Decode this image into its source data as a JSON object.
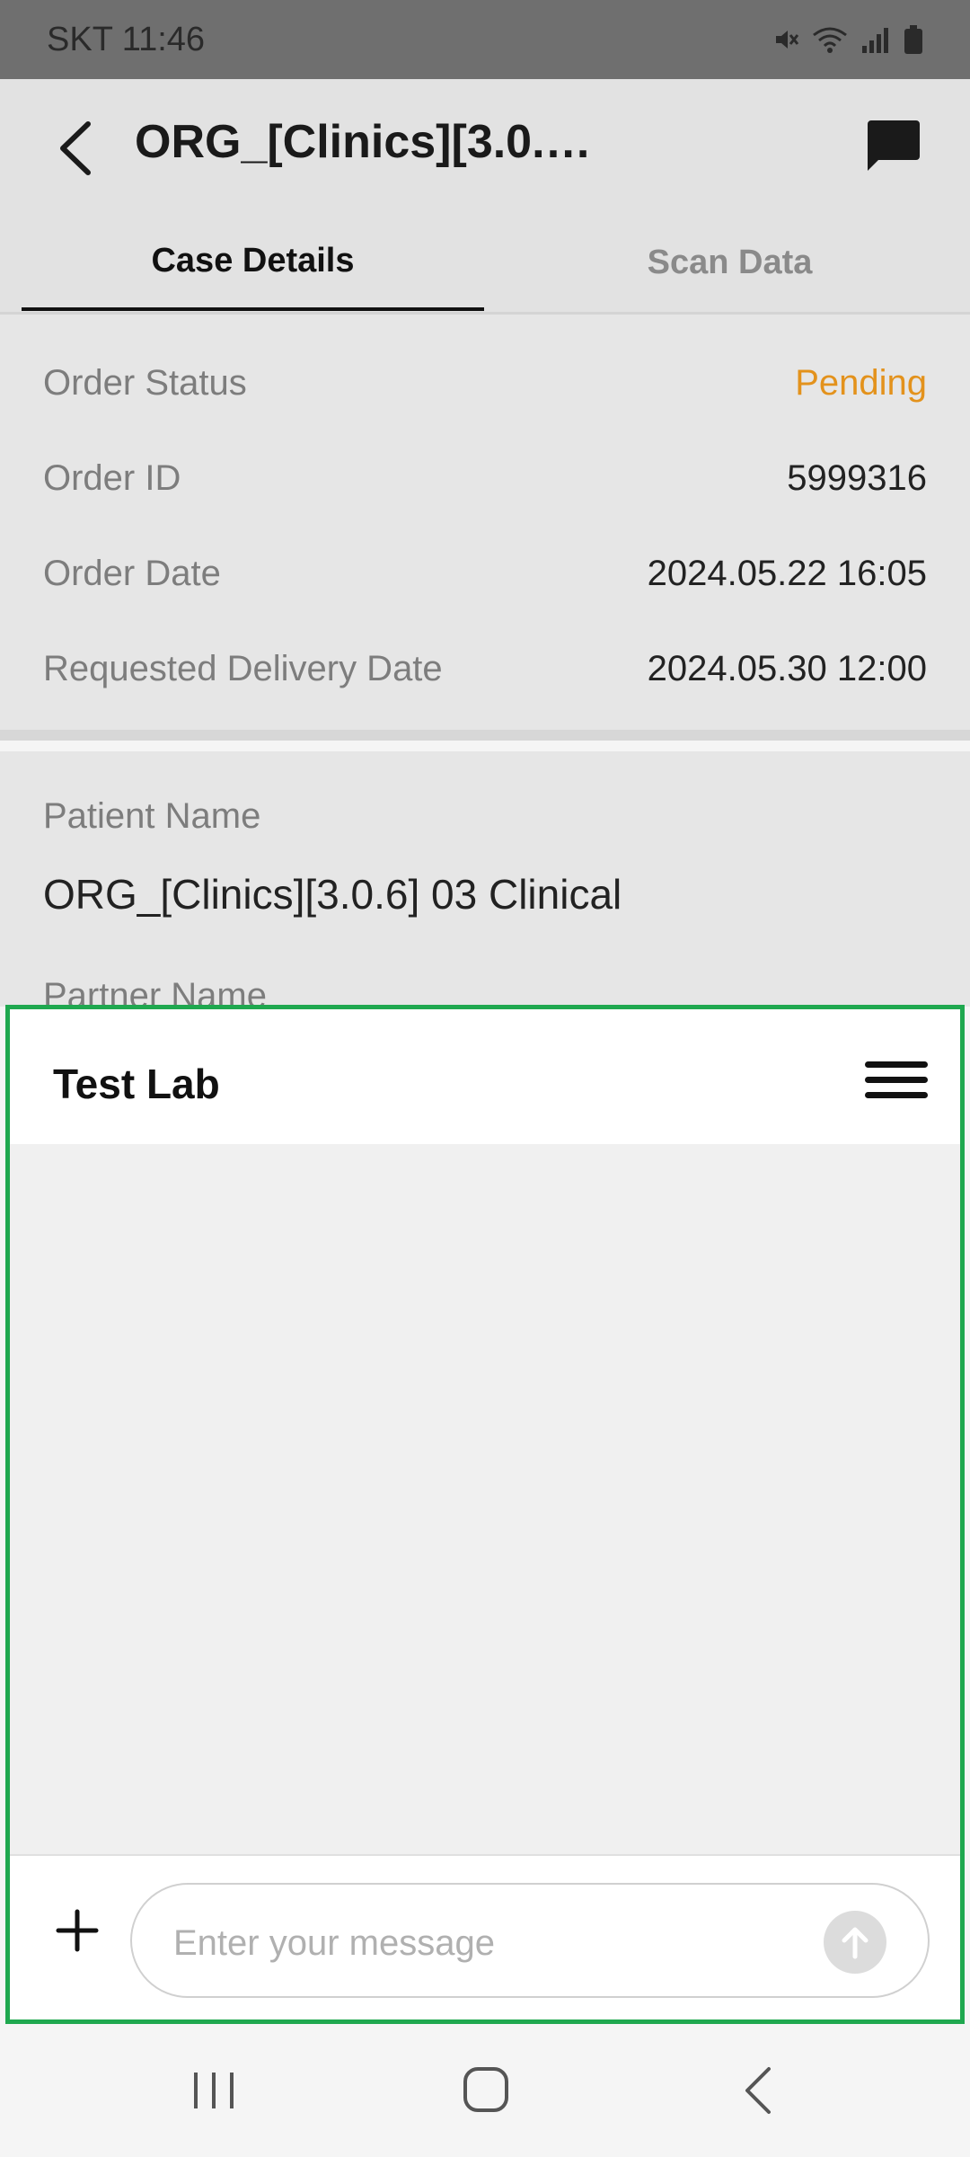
{
  "status_bar": {
    "carrier_time": "SKT 11:46"
  },
  "header": {
    "title": "ORG_[Clinics][3.0.6..."
  },
  "tabs": [
    {
      "label": "Case Details",
      "active": true
    },
    {
      "label": "Scan Data",
      "active": false
    }
  ],
  "order_info": {
    "status_label": "Order Status",
    "status_value": "Pending",
    "id_label": "Order ID",
    "id_value": "5999316",
    "date_label": "Order Date",
    "date_value": "2024.05.22 16:05",
    "delivery_label": "Requested Delivery Date",
    "delivery_value": "2024.05.30 12:00"
  },
  "patient": {
    "name_label": "Patient Name",
    "name_value": "ORG_[Clinics][3.0.6] 03 Clinical",
    "partner_label": "Partner Name"
  },
  "chat": {
    "title": "Test Lab",
    "input_placeholder": "Enter your message"
  },
  "colors": {
    "pending": "#e3921c",
    "highlight_border": "#1fa84f"
  }
}
